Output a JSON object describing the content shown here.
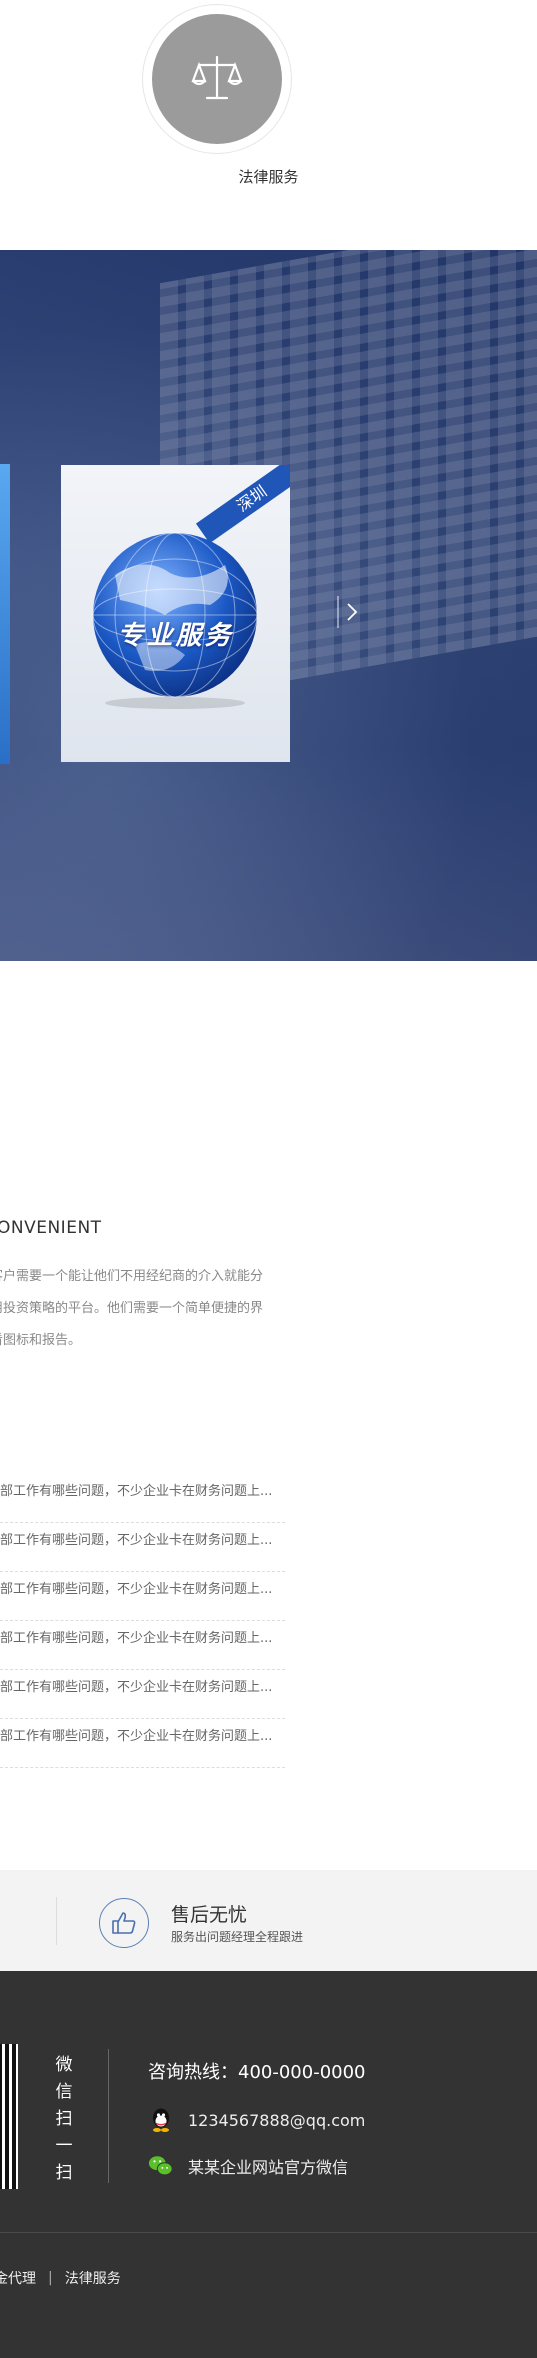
{
  "service": {
    "label": "法律服务",
    "icon": "scales-icon"
  },
  "banner": {
    "card_badge": "深圳",
    "card_text": "专业服务",
    "next_icon": "chevron-right-icon"
  },
  "about": {
    "title": "ONVENIENT",
    "lines": [
      "客户需要一个能让他们不用经纪商的介入就能分",
      "用投资策略的平台。他们需要一个简单便捷的界",
      "看图标和报告。"
    ]
  },
  "news": [
    "部工作有哪些问题，不少企业卡在财务问题上...",
    "部工作有哪些问题，不少企业卡在财务问题上...",
    "部工作有哪些问题，不少企业卡在财务问题上...",
    "部工作有哪些问题，不少企业卡在财务问题上...",
    "部工作有哪些问题，不少企业卡在财务问题上...",
    "部工作有哪些问题，不少企业卡在财务问题上..."
  ],
  "after_sales": {
    "title": "售后无忧",
    "subtitle": "服务出问题经理全程跟进",
    "icon": "thumbs-up-icon"
  },
  "footer": {
    "wechat_scan": [
      "微",
      "信",
      "扫",
      "一",
      "扫"
    ],
    "hotline": "咨询热线：400-000-0000",
    "qq": "1234567888@qq.com",
    "wechat": "某某企业网站官方微信",
    "links": [
      "金代理",
      "法律服务"
    ],
    "link_separator": "|"
  },
  "colors": {
    "accent": "#1f56b8",
    "footer_bg": "#333333",
    "band_bg": "#f3f3f3"
  }
}
